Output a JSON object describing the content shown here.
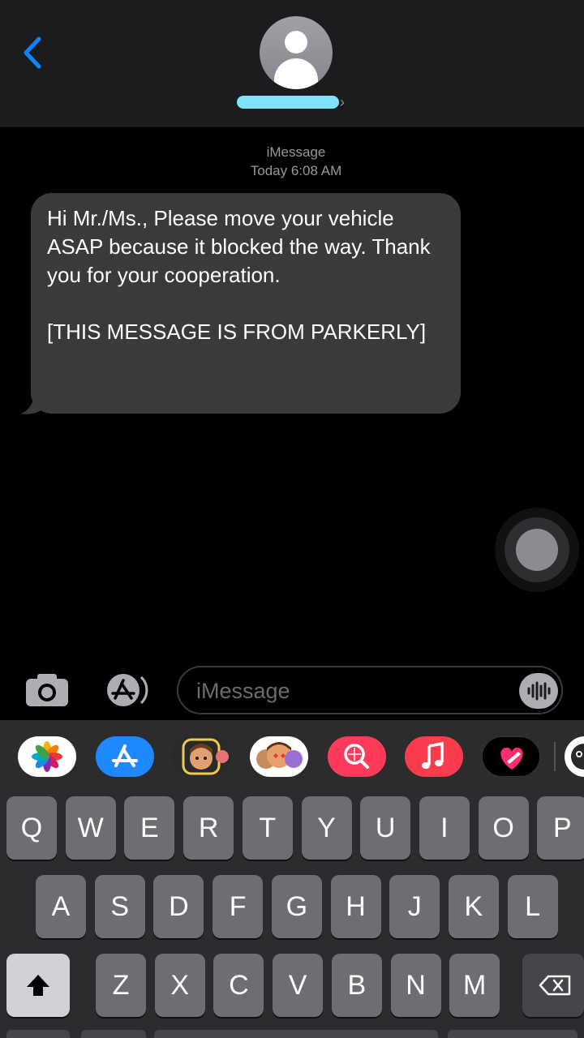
{
  "conversation": {
    "service": "iMessage",
    "timestamp": "Today 6:08 AM",
    "message_text": "Hi Mr./Ms., Please move your vehicle ASAP because it blocked the way. Thank you for your cooperation.\n\n[THIS MESSAGE IS FROM PARKERLY]"
  },
  "composer": {
    "placeholder": "iMessage"
  },
  "app_drawer": [
    "photos-app",
    "app-store-app",
    "memoji-app",
    "memoji-stickers-app",
    "image-search-app",
    "music-app",
    "digital-touch-app",
    "partial-app"
  ],
  "keyboard": {
    "row1": [
      "Q",
      "W",
      "E",
      "R",
      "T",
      "Y",
      "U",
      "I",
      "O",
      "P"
    ],
    "row2": [
      "A",
      "S",
      "D",
      "F",
      "G",
      "H",
      "J",
      "K",
      "L"
    ],
    "row3": [
      "Z",
      "X",
      "C",
      "V",
      "B",
      "N",
      "M"
    ]
  },
  "colors": {
    "accent": "#0a84ff",
    "bubble": "#3a3a3c",
    "header": "#1c1c1e",
    "keyboard": "#2c2c2e",
    "key": "#6e6e72"
  }
}
